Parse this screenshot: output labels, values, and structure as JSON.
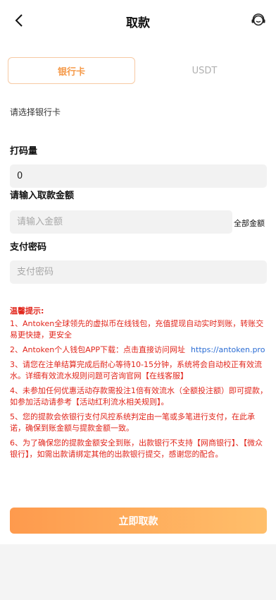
{
  "header": {
    "title": "取款",
    "back_icon": "chevron-left-icon",
    "service_icon": "customer-service-icon"
  },
  "tabs": [
    {
      "label": "银行卡",
      "active": true
    },
    {
      "label": "USDT",
      "active": false
    }
  ],
  "bank_card": {
    "select_label": "请选择银行卡"
  },
  "wagering": {
    "label": "打码量",
    "value": "0"
  },
  "amount": {
    "label": "请输入取款金额",
    "placeholder": "请输入金额",
    "all_label": "全部金额"
  },
  "password": {
    "label": "支付密码",
    "placeholder": "支付密码"
  },
  "tips": {
    "title": "温馨提示:",
    "items": [
      "1、Antoken全球领先的虚拟币在线钱包，充值提现自动实时到账，转账交易更快捷，更安全",
      "2、Antoken个人钱包APP下载：点击直接访问网址",
      "3、请您在注单结算完成后耐心等待10-15分钟，系统将会自动校正有效流水。详细有效流水规则问题可咨询官网【在线客服】",
      "4、未参加任何优惠活动存款需投注1倍有效流水（全额投注额）即可提款，如参加活动请参考【活动红利流水相关规则】。",
      "5、您的提款会依银行支付风控系统判定由一笔或多笔进行支付，在此承诺，确保到账金额与提款金额一致。",
      "6、为了确保您的提款金额安全到账，出款银行不支持【网商银行】、【微众银行】，如需出款请绑定其他的出款银行提交，感谢您的配合。"
    ],
    "link": "https://antoken.pro"
  },
  "submit_label": "立即取款",
  "colors": {
    "accent": "#f59a4a",
    "tip_text": "#e1251b",
    "link": "#2a6cd4",
    "button_start": "#fe9a4d",
    "button_end": "#ffbf6b"
  }
}
